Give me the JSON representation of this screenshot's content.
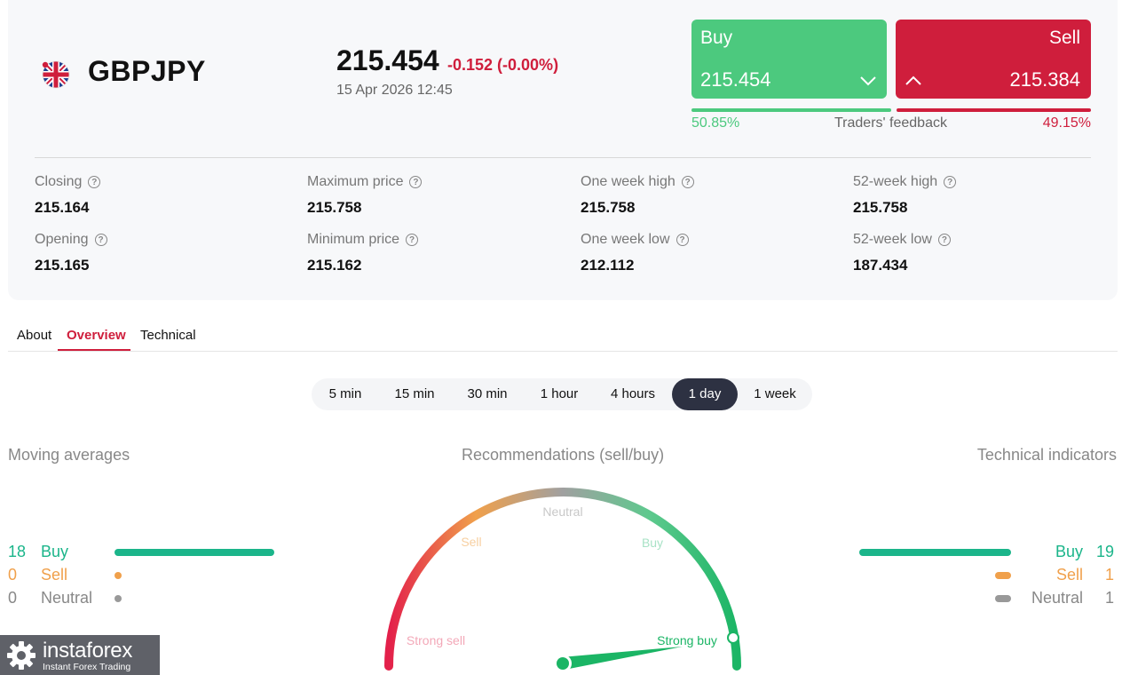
{
  "instrument": {
    "symbol": "GBPJPY",
    "price": "215.454",
    "change": "-0.152 (-0.00%)",
    "datetime": "15 Apr 2026 12:45"
  },
  "trade": {
    "buy_label": "Buy",
    "buy_price": "215.454",
    "sell_label": "Sell",
    "sell_price": "215.384"
  },
  "feedback": {
    "label": "Traders' feedback",
    "buy_pct": "50.85%",
    "sell_pct": "49.15%",
    "buy_fraction": 0.5085
  },
  "stats": [
    {
      "label": "Closing",
      "value": "215.164"
    },
    {
      "label": "Maximum price",
      "value": "215.758"
    },
    {
      "label": "One week high",
      "value": "215.758"
    },
    {
      "label": "52-week high",
      "value": "215.758"
    },
    {
      "label": "Opening",
      "value": "215.165"
    },
    {
      "label": "Minimum price",
      "value": "215.162"
    },
    {
      "label": "One week low",
      "value": "212.112"
    },
    {
      "label": "52-week low",
      "value": "187.434"
    }
  ],
  "tabs": [
    {
      "label": "About",
      "active": false
    },
    {
      "label": "Overview",
      "active": true
    },
    {
      "label": "Technical",
      "active": false
    }
  ],
  "periods": [
    {
      "label": "5 min",
      "active": false
    },
    {
      "label": "15 min",
      "active": false
    },
    {
      "label": "30 min",
      "active": false
    },
    {
      "label": "1 hour",
      "active": false
    },
    {
      "label": "4 hours",
      "active": false
    },
    {
      "label": "1 day",
      "active": true
    },
    {
      "label": "1 week",
      "active": false
    }
  ],
  "moving_averages": {
    "title": "Moving averages",
    "buy": {
      "label": "Buy",
      "count": "18"
    },
    "sell": {
      "label": "Sell",
      "count": "0"
    },
    "neutral": {
      "label": "Neutral",
      "count": "0"
    }
  },
  "recommendations": {
    "title": "Recommendations (sell/buy)",
    "labels": {
      "strong_sell": "Strong sell",
      "sell": "Sell",
      "neutral": "Neutral",
      "buy": "Buy",
      "strong_buy": "Strong buy"
    },
    "needle_position": "Strong buy"
  },
  "technical_indicators": {
    "title": "Technical indicators",
    "buy": {
      "label": "Buy",
      "count": "19"
    },
    "sell": {
      "label": "Sell",
      "count": "1"
    },
    "neutral": {
      "label": "Neutral",
      "count": "1"
    }
  },
  "logo": {
    "brand": "instaforex",
    "tagline": "Instant Forex Trading"
  },
  "colors": {
    "buy": "#4cc97e",
    "sell": "#cf1e3c",
    "ma_buy": "#1bb58a",
    "ma_sell": "#f0a04b",
    "neutral": "#999999"
  }
}
